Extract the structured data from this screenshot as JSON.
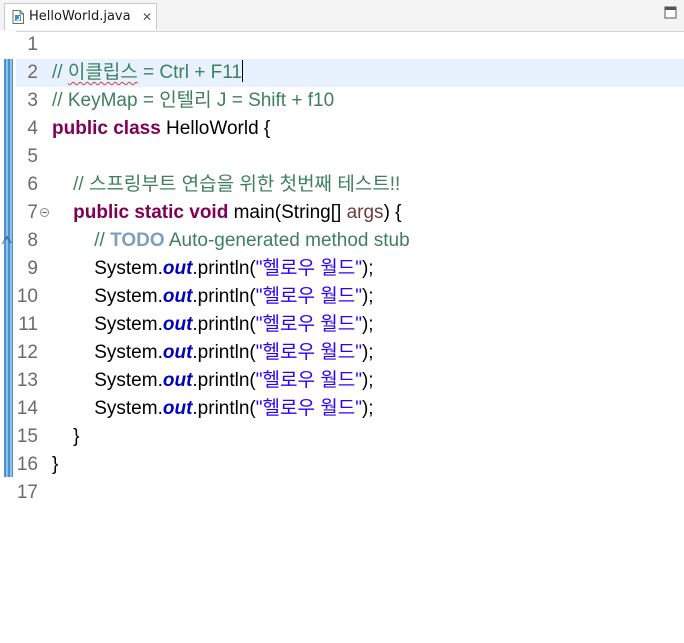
{
  "tab": {
    "filename": "HelloWorld.java",
    "close_glyph": "✕"
  },
  "lines": [
    {
      "num": "1"
    },
    {
      "num": "2",
      "comment_a": "// ",
      "comment_b": "이클립스",
      "comment_c": " = Ctrl + F11"
    },
    {
      "num": "3",
      "text": "// KeyMap = 인텔리 J = Shift + f10"
    },
    {
      "num": "4",
      "kw": "public class",
      "rest": " HelloWorld {"
    },
    {
      "num": "5"
    },
    {
      "num": "6",
      "indent": "    ",
      "text": "// 스프링부트 연습을 위한 첫번째 테스트!!"
    },
    {
      "num": "7",
      "indent": "    ",
      "kw": "public static void",
      "mid": " main(String[] ",
      "param": "args",
      "rest": ") {"
    },
    {
      "num": "8",
      "indent": "        ",
      "c1": "// ",
      "todo": "TODO",
      "c2": " Auto-generated method stub"
    },
    {
      "num": "9",
      "indent": "        ",
      "a": "System.",
      "field": "out",
      "b": ".println(",
      "str": "\"헬로우 월드\"",
      "c": ");"
    },
    {
      "num": "10",
      "indent": "        ",
      "a": "System.",
      "field": "out",
      "b": ".println(",
      "str": "\"헬로우 월드\"",
      "c": ");"
    },
    {
      "num": "11",
      "indent": "        ",
      "a": "System.",
      "field": "out",
      "b": ".println(",
      "str": "\"헬로우 월드\"",
      "c": ");"
    },
    {
      "num": "12",
      "indent": "        ",
      "a": "System.",
      "field": "out",
      "b": ".println(",
      "str": "\"헬로우 월드\"",
      "c": ");"
    },
    {
      "num": "13",
      "indent": "        ",
      "a": "System.",
      "field": "out",
      "b": ".println(",
      "str": "\"헬로우 월드\"",
      "c": ");"
    },
    {
      "num": "14",
      "indent": "        ",
      "a": "System.",
      "field": "out",
      "b": ".println(",
      "str": "\"헬로우 월드\"",
      "c": ");"
    },
    {
      "num": "15",
      "indent": "    ",
      "text": "}"
    },
    {
      "num": "16",
      "text": "}"
    },
    {
      "num": "17"
    }
  ],
  "colors": {
    "comment": "#3f7f5f",
    "keyword": "#7f0055",
    "string": "#2a00ff",
    "field": "#0000c0",
    "todo": "#7f9fbf",
    "current_line": "#e8f2fe",
    "change_bar": "#5b9bd5"
  },
  "icons": [
    "java-file-icon",
    "close-icon",
    "maximize-icon",
    "fold-collapse-icon",
    "override-marker-icon"
  ]
}
